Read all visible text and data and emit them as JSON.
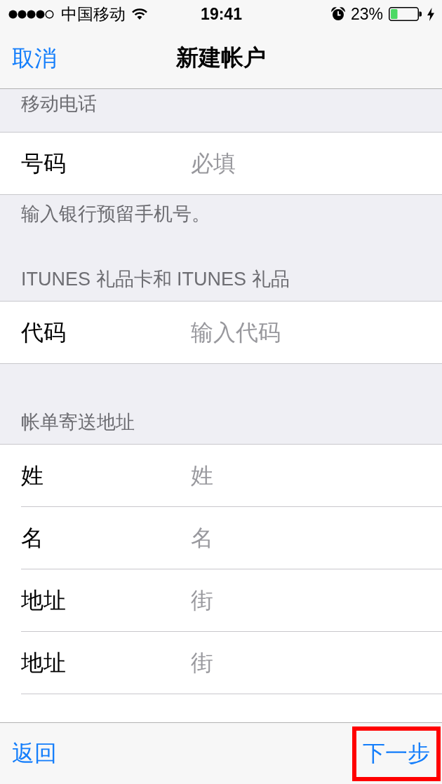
{
  "status_bar": {
    "carrier": "中国移动",
    "time": "19:41",
    "battery": "23%"
  },
  "nav_bar": {
    "cancel": "取消",
    "title": "新建帐户"
  },
  "sections": [
    {
      "header": "移动电话",
      "rows": [
        {
          "label": "号码",
          "placeholder": "必填"
        }
      ],
      "footer": "输入银行预留手机号。"
    },
    {
      "header": "ITUNES 礼品卡和 ITUNES 礼品",
      "rows": [
        {
          "label": "代码",
          "placeholder": "输入代码"
        }
      ]
    },
    {
      "header": "帐单寄送地址",
      "rows": [
        {
          "label": "姓",
          "placeholder": "姓"
        },
        {
          "label": "名",
          "placeholder": "名"
        },
        {
          "label": "地址",
          "placeholder": "街"
        },
        {
          "label": "地址",
          "placeholder": "街"
        }
      ]
    }
  ],
  "toolbar": {
    "back": "返回",
    "next": {
      "label": "下一步",
      "highlighted": true
    }
  }
}
